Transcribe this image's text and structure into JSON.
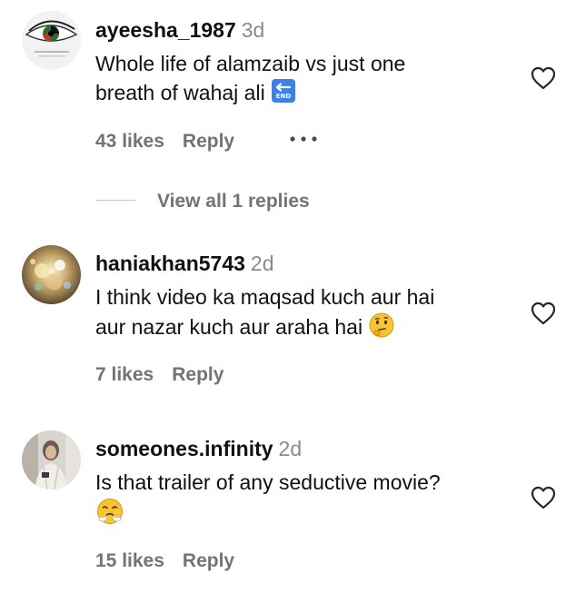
{
  "comments": [
    {
      "username": "ayeesha_1987",
      "time": "3d",
      "text_lines": [
        "Whole life of alamzaib vs just one",
        "breath of wahaj ali"
      ],
      "emoji": "end-arrow-emoji",
      "emoji_text": "END",
      "likes": "43 likes",
      "reply": "Reply",
      "view_replies": "View all 1 replies",
      "avatar": "eye-flag-avatar"
    },
    {
      "username": "haniakhan5743",
      "time": "2d",
      "text_lines": [
        "I think video ka maqsad kuch aur hai",
        "aur nazar kuch aur araha hai"
      ],
      "emoji": "thinking-face-emoji",
      "likes": "7 likes",
      "reply": "Reply",
      "avatar": "sparkle-avatar"
    },
    {
      "username": "someones.infinity",
      "time": "2d",
      "text_lines": [
        "Is that trailer of any seductive movie?"
      ],
      "emoji": "face-with-steam-emoji",
      "likes": "15 likes",
      "reply": "Reply",
      "avatar": "person-photo-avatar"
    }
  ],
  "icons": {
    "like": "heart-outline-icon",
    "more": "more-options-icon"
  },
  "colors": {
    "text": "#111111",
    "muted": "#737373",
    "timestamp": "#8a8a8a",
    "divider": "#c7c7c7"
  }
}
